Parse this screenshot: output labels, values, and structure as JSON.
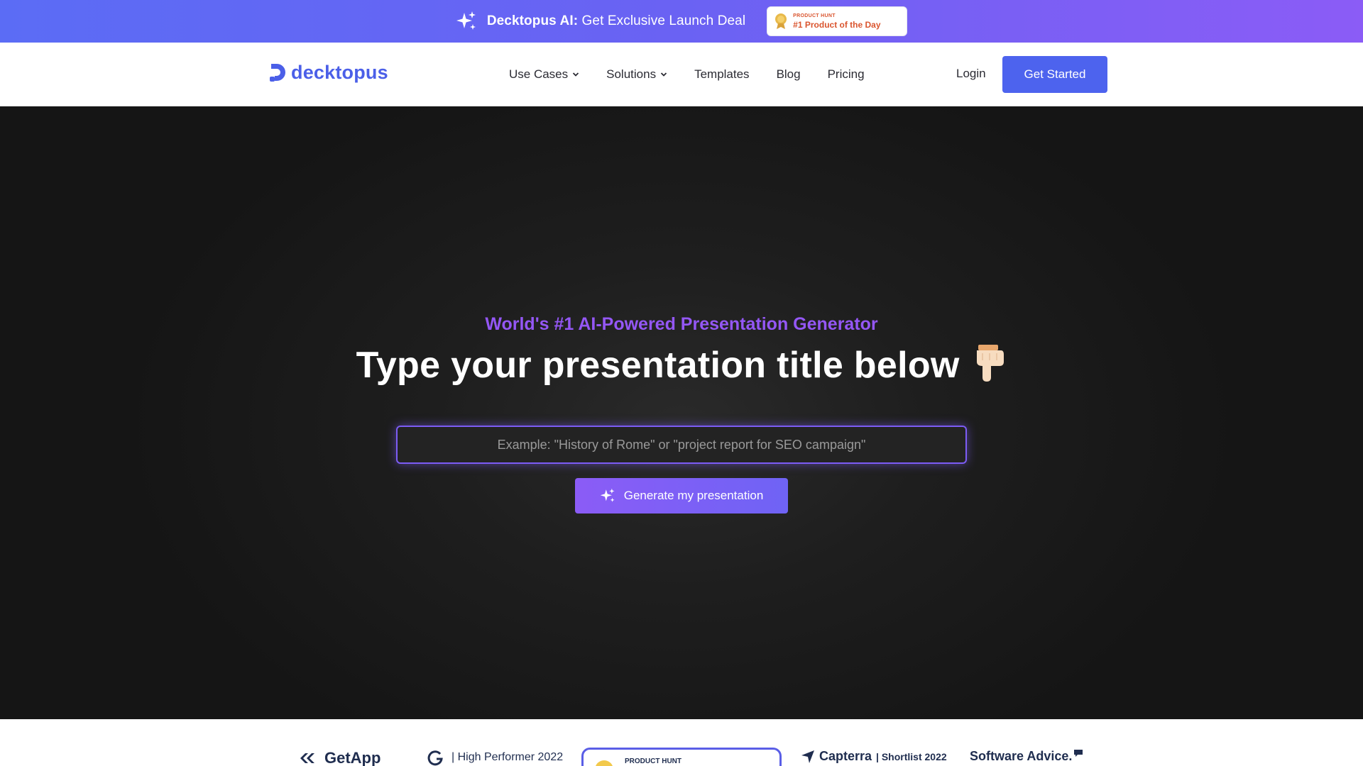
{
  "promo": {
    "brand": "Decktopus AI:",
    "text": "Get Exclusive Launch Deal",
    "badge_small": "PRODUCT HUNT",
    "badge_big": "#1 Product of the Day"
  },
  "nav": {
    "logo": "decktopus",
    "items": [
      {
        "label": "Use Cases",
        "has_dropdown": true
      },
      {
        "label": "Solutions",
        "has_dropdown": true
      },
      {
        "label": "Templates",
        "has_dropdown": false
      },
      {
        "label": "Blog",
        "has_dropdown": false
      },
      {
        "label": "Pricing",
        "has_dropdown": false
      }
    ],
    "login": "Login",
    "cta": "Get Started"
  },
  "hero": {
    "eyebrow": "World's #1 AI-Powered Presentation Generator",
    "headline": "Type your presentation title below",
    "input_placeholder": "Example: \"History of Rome\" or \"project report for SEO campaign\"",
    "input_value": "",
    "button": "Generate my presentation"
  },
  "awards": {
    "getapp": "GetApp",
    "g2": "| High Performer 2022",
    "producthunt": "PRODUCT HUNT",
    "capterra": "Capterra",
    "capterra_sub": "| Shortlist 2022",
    "softwareadvice": "Software Advice."
  },
  "colors": {
    "accent": "#4d63ee",
    "purple": "#9457f5",
    "banner_start": "#5b6cf5",
    "banner_end": "#8b5cf6"
  },
  "icons": [
    "sparkle-icon",
    "medal-icon",
    "decktopus-logo-icon",
    "chevron-down-icon",
    "pointing-down-hand-icon"
  ]
}
